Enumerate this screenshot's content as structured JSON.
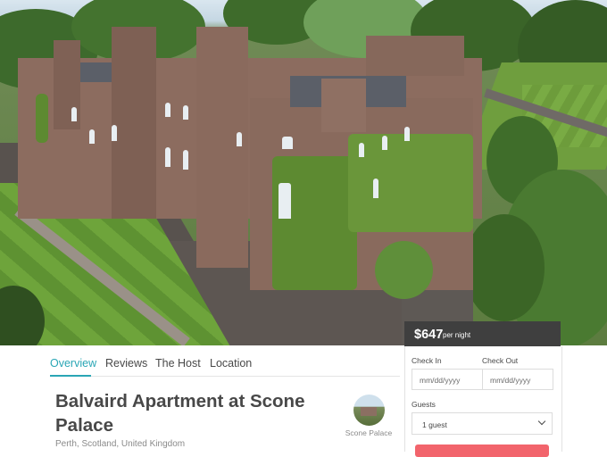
{
  "nav": {
    "tabs": [
      {
        "label": "Overview",
        "active": true
      },
      {
        "label": "Reviews",
        "active": false
      },
      {
        "label": "The Host",
        "active": false
      },
      {
        "label": "Location",
        "active": false
      }
    ]
  },
  "listing": {
    "title": "Balvaird Apartment at Scone Palace",
    "location": "Perth, Scotland, United Kingdom",
    "host_name": "Scone Palace"
  },
  "booking": {
    "price": "$647",
    "price_unit": "per night",
    "check_in_label": "Check In",
    "check_in_placeholder": "mm/dd/yyyy",
    "check_out_label": "Check Out",
    "check_out_placeholder": "mm/dd/yyyy",
    "guests_label": "Guests",
    "guests_value": "1 guest"
  },
  "colors": {
    "accent": "#2aa6b5",
    "book_button": "#f2646c",
    "price_bar": "#3f3f3f"
  }
}
